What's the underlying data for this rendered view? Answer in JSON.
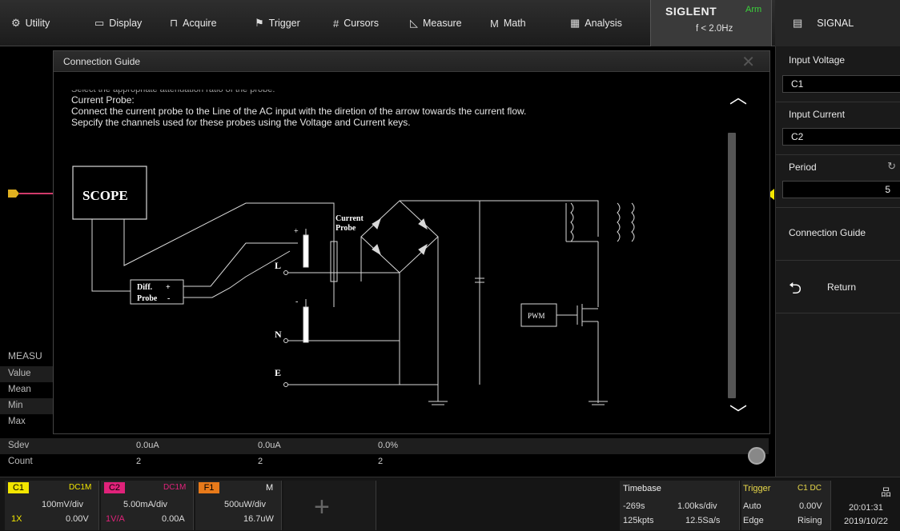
{
  "menu": {
    "utility": "Utility",
    "display": "Display",
    "acquire": "Acquire",
    "trigger": "Trigger",
    "cursors": "Cursors",
    "measure": "Measure",
    "math": "Math",
    "analysis": "Analysis"
  },
  "brand": {
    "logo": "SIGLENT",
    "status": "Arm",
    "freq": "f < 2.0Hz"
  },
  "signal_tab": "SIGNAL",
  "right_panel": {
    "input_voltage_label": "Input Voltage",
    "input_voltage_value": "C1",
    "input_current_label": "Input Current",
    "input_current_value": "C2",
    "period_label": "Period",
    "period_value": "5",
    "connection_guide": "Connection Guide",
    "return": "Return"
  },
  "dialog": {
    "title": "Connection Guide",
    "lines": [
      "Select the appropriate attenuation ratio of the probe.",
      "Current Probe:",
      "  Connect the current probe to the Line of the AC input with the diretion of the arrow towards the current flow.",
      "Sepcify the channels used for these probes using the Voltage and Current keys."
    ],
    "diagram": {
      "scope": "SCOPE",
      "current_probe_1": "Current",
      "current_probe_2": "Probe",
      "diff_probe_1": "Diff.",
      "diff_probe_2": "Probe",
      "plus": "+",
      "minus": "-",
      "L": "L",
      "N": "N",
      "E": "E",
      "pwm": "PWM"
    }
  },
  "measure": {
    "header": "MEASU",
    "rows": [
      {
        "label": "Value",
        "c1": "",
        "c2": "",
        "c3": ""
      },
      {
        "label": "Mean",
        "c1": "",
        "c2": "",
        "c3": ""
      },
      {
        "label": "Min",
        "c1": "",
        "c2": "",
        "c3": ""
      },
      {
        "label": "Max",
        "c1": "",
        "c2": "",
        "c3": ""
      },
      {
        "label": "Sdev",
        "c1": "0.0uA",
        "c2": "0.0uA",
        "c3": "0.0%"
      },
      {
        "label": "Count",
        "c1": "2",
        "c2": "2",
        "c3": "2"
      }
    ]
  },
  "channels": {
    "c1": {
      "tag": "C1",
      "coupling": "DC1M",
      "scale": "100mV/div",
      "offset": "0.00V",
      "probe": "1X",
      "color": "#f2e600"
    },
    "c2": {
      "tag": "C2",
      "coupling": "DC1M",
      "scale": "5.00mA/div",
      "offset": "0.00A",
      "probe": "1V/A",
      "color": "#e0227a"
    },
    "f1": {
      "tag": "F1",
      "scale": "",
      "offset": "",
      "color": "#e87a1a"
    },
    "m": {
      "tag": "M",
      "scale": "500uW/div",
      "offset": "16.7uW"
    }
  },
  "timebase": {
    "label": "Timebase",
    "delay": "-269s",
    "scale": "1.00ks/div",
    "points": "125kpts",
    "rate": "12.5Sa/s"
  },
  "trigger": {
    "label": "Trigger",
    "mode": "Auto",
    "type": "Edge",
    "source": "C1 DC",
    "level": "0.00V",
    "slope": "Rising"
  },
  "clock": {
    "time": "20:01:31",
    "date": "2019/10/22"
  }
}
